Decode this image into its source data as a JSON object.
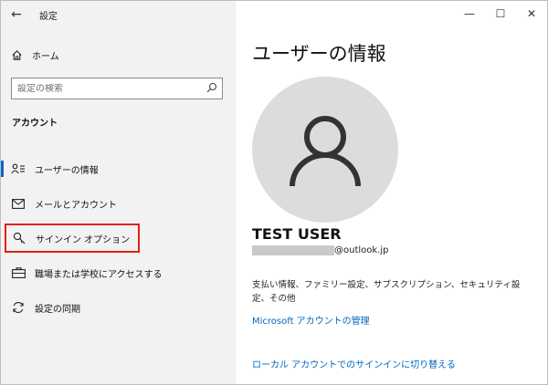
{
  "window": {
    "title": "設定",
    "controls": {
      "minimize": "—",
      "maximize": "☐",
      "close": "✕"
    }
  },
  "sidebar": {
    "back_icon": "←",
    "home_label": "ホーム",
    "search_placeholder": "設定の検索",
    "section_title": "アカウント",
    "items": [
      {
        "label": "ユーザーの情報",
        "icon": "user-info-icon",
        "active": true
      },
      {
        "label": "メールとアカウント",
        "icon": "mail-icon"
      },
      {
        "label": "サインイン オプション",
        "icon": "key-icon",
        "highlighted": true
      },
      {
        "label": "職場または学校にアクセスする",
        "icon": "briefcase-icon"
      },
      {
        "label": "設定の同期",
        "icon": "sync-icon"
      }
    ]
  },
  "main": {
    "title": "ユーザーの情報",
    "user_name": "TEST USER",
    "email_domain": "@outlook.jp",
    "description": "支払い情報、ファミリー設定、サブスクリプション、セキュリティ設定、その他",
    "ms_account_link": "Microsoft アカウントの管理",
    "local_account_link": "ローカル アカウントでのサインインに切り替える"
  },
  "colors": {
    "sidebar_bg": "#f2f2f2",
    "accent": "#0067c0",
    "highlight_border": "#e0201b",
    "avatar_bg": "#dcdcdc"
  }
}
